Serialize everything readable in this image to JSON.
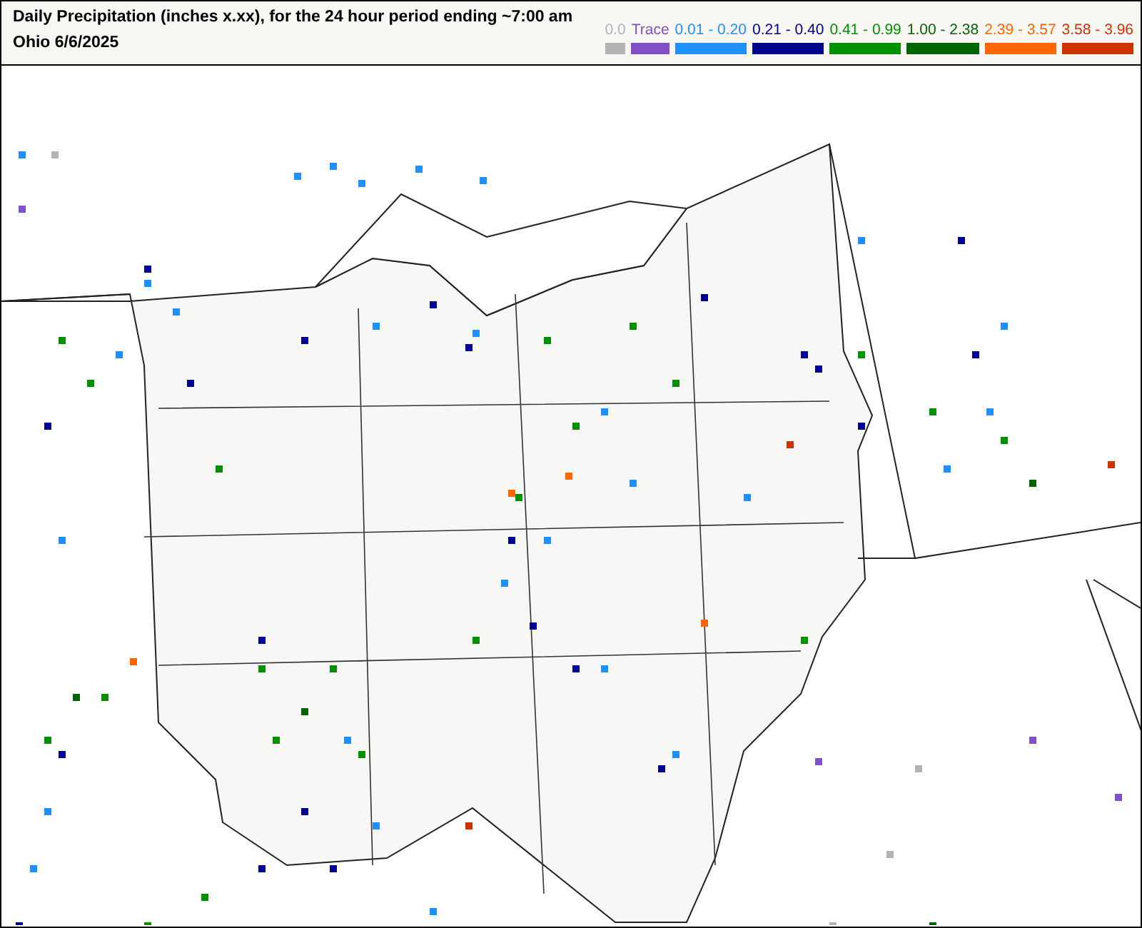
{
  "header": {
    "title": "Daily Precipitation (inches  x.xx),  for the 24 hour period ending ~7:00 am",
    "subtitle": "Ohio 6/6/2025"
  },
  "legend": [
    {
      "label": "0.0",
      "color": "#b4b4b4"
    },
    {
      "label": "Trace",
      "color": "#8050c8"
    },
    {
      "label": "0.01 - 0.20",
      "color": "#1e90ff"
    },
    {
      "label": "0.21 - 0.40",
      "color": "#000090"
    },
    {
      "label": "0.41 - 0.99",
      "color": "#009000"
    },
    {
      "label": "1.00 - 2.38",
      "color": "#006400"
    },
    {
      "label": "2.39 - 3.57",
      "color": "#ff6600"
    },
    {
      "label": "3.58 - 3.96",
      "color": "#cc3300"
    }
  ]
}
